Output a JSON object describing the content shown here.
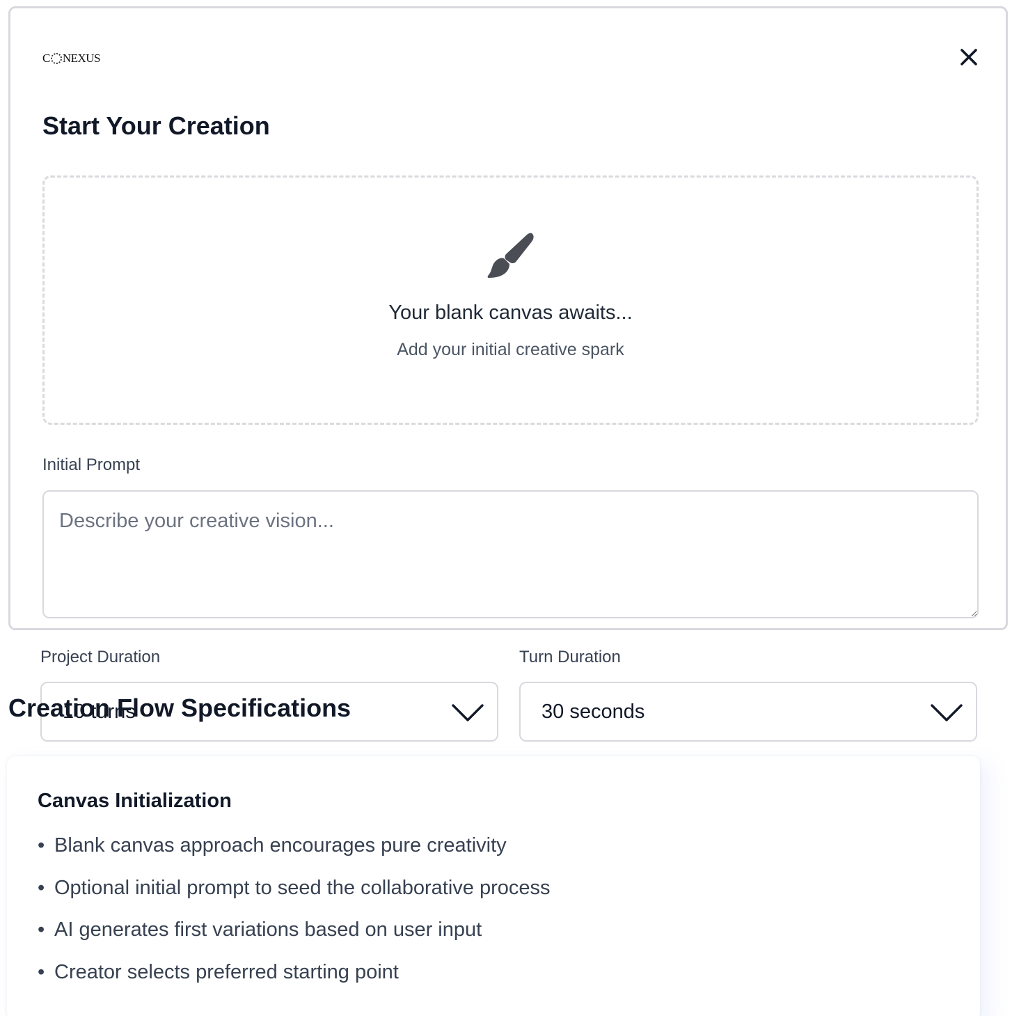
{
  "logo": {
    "text_left": "C",
    "text_right": "NEXUS"
  },
  "modal": {
    "title": "Start Your Creation",
    "canvas": {
      "heading": "Your blank canvas awaits...",
      "subheading": "Add your initial creative spark"
    },
    "prompt": {
      "label": "Initial Prompt",
      "placeholder": "Describe your creative vision..."
    },
    "project_duration": {
      "label": "Project Duration",
      "value": "10 turns"
    },
    "turn_duration": {
      "label": "Turn Duration",
      "value": "30 seconds"
    }
  },
  "flow": {
    "title": "Creation Flow Specifications"
  },
  "spec": {
    "title": "Canvas Initialization",
    "bullet": "•",
    "items": [
      "Blank canvas approach encourages pure creativity",
      "Optional initial prompt to seed the collaborative process",
      "AI generates first variations based on user input",
      "Creator selects preferred starting point"
    ]
  }
}
